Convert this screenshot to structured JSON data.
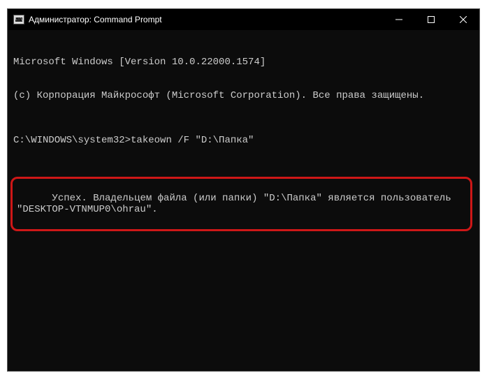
{
  "window": {
    "title": "Администратор: Command Prompt"
  },
  "terminal": {
    "line1": "Microsoft Windows [Version 10.0.22000.1574]",
    "line2": "(c) Корпорация Майкрософт (Microsoft Corporation). Все права защищены.",
    "prompt": "C:\\WINDOWS\\system32>",
    "command": "takeown /F \"D:\\Папка\"",
    "result": "Успех. Владельцем файла (или папки) \"D:\\Папка\" является пользователь \"DESKTOP-VTNMUP0\\ohrau\"."
  }
}
